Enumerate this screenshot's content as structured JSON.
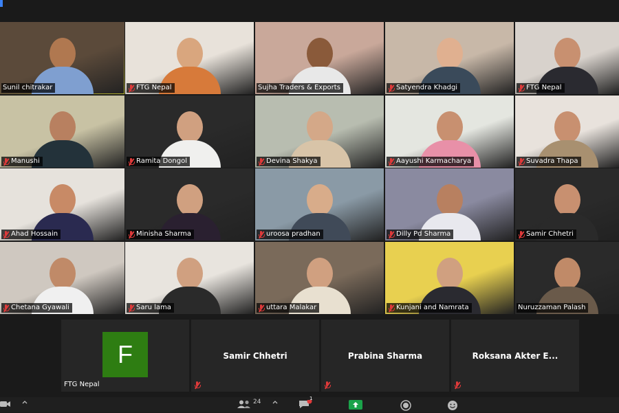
{
  "tiles": [
    {
      "name": "Sunil chitrakar",
      "muted": false,
      "active": true,
      "bg": "#5b4a3a",
      "skin": "#b07850",
      "shirt": "#7f9fd0"
    },
    {
      "name": "FTG Nepal",
      "muted": true,
      "bg": "#e8e2da",
      "skin": "#d9a67e",
      "shirt": "#d77a3a"
    },
    {
      "name": "Sujha Traders & Exports",
      "muted": false,
      "bg": "#c9a89a",
      "skin": "#8a5a3a",
      "shirt": "#e8e8e8"
    },
    {
      "name": "Satyendra Khadgi",
      "muted": true,
      "bg": "#c8b8a8",
      "skin": "#e0b090",
      "shirt": "#3a4a5a"
    },
    {
      "name": "FTG Nepal",
      "muted": true,
      "bg": "#d8d2cc",
      "skin": "#c89070",
      "shirt": "#2a2a30"
    },
    {
      "name": "Manushi",
      "muted": true,
      "bg": "#c8c2a4",
      "skin": "#b88060",
      "shirt": "#23323a"
    },
    {
      "name": "Ramita Dongol",
      "muted": true,
      "bg": "#2a2a2a",
      "skin": "#d0a080",
      "shirt": "#f0f0ee"
    },
    {
      "name": "Devina Shakya",
      "muted": true,
      "bg": "#b8bdb0",
      "skin": "#d4a888",
      "shirt": "#d8c4a8"
    },
    {
      "name": "Aayushi Karmacharya",
      "muted": true,
      "bg": "#e4e6e0",
      "skin": "#c89070",
      "shirt": "#e890a8"
    },
    {
      "name": "Suvadra Thapa",
      "muted": true,
      "bg": "#e8e2dc",
      "skin": "#c89070",
      "shirt": "#a89070"
    },
    {
      "name": "Ahad Hossain",
      "muted": true,
      "bg": "#e6e2dc",
      "skin": "#c88a66",
      "shirt": "#2a2a50"
    },
    {
      "name": "Minisha Sharma",
      "muted": true,
      "bg": "#2a2a2a",
      "skin": "#d0a080",
      "shirt": "#2a2030"
    },
    {
      "name": "uroosa pradhan",
      "muted": true,
      "bg": "#8a9aa6",
      "skin": "#d8ac8a",
      "shirt": "#404a58"
    },
    {
      "name": "Dilly Pd Sharma",
      "muted": true,
      "bg": "#8a8aa0",
      "skin": "#b88060",
      "shirt": "#e8e8ee"
    },
    {
      "name": "Samir Chhetri",
      "muted": true,
      "bg": "#2a2a2a",
      "skin": "#c89070",
      "shirt": "#2a2a2a"
    },
    {
      "name": "Chetana Gyawali",
      "muted": true,
      "bg": "#cfc8c0",
      "skin": "#c08a68",
      "shirt": "#f0f0f0"
    },
    {
      "name": "Saru lama",
      "muted": true,
      "bg": "#e8e4de",
      "skin": "#d0a080",
      "shirt": "#2a2a2a"
    },
    {
      "name": "uttara Malakar",
      "muted": true,
      "bg": "#7a6a5a",
      "skin": "#d0a080",
      "shirt": "#e8e0d0"
    },
    {
      "name": "Kunjani and Namrata",
      "muted": true,
      "bg": "#e8d050",
      "skin": "#d0a080",
      "shirt": "#2a2a30"
    },
    {
      "name": "Nuruzzaman Palash",
      "muted": false,
      "bg": "#2a2a2a",
      "skin": "#c08a68",
      "shirt": "#6a5a4a"
    }
  ],
  "bottom_tiles": [
    {
      "name": "FTG Nepal",
      "avatar_letter": "F",
      "show_label": true,
      "muted": false
    },
    {
      "name": "Samir Chhetri",
      "muted": true
    },
    {
      "name": "Prabina Sharma",
      "muted": true
    },
    {
      "name": "Roksana Akter E...",
      "muted": true
    }
  ],
  "toolbar": {
    "participants_count": "24",
    "chat_badge": "1"
  },
  "colors": {
    "accent": "#2e7d12",
    "muted_mic": "#e03a3a",
    "share_green": "#1aa34a",
    "active_border": "#e6e63a"
  }
}
